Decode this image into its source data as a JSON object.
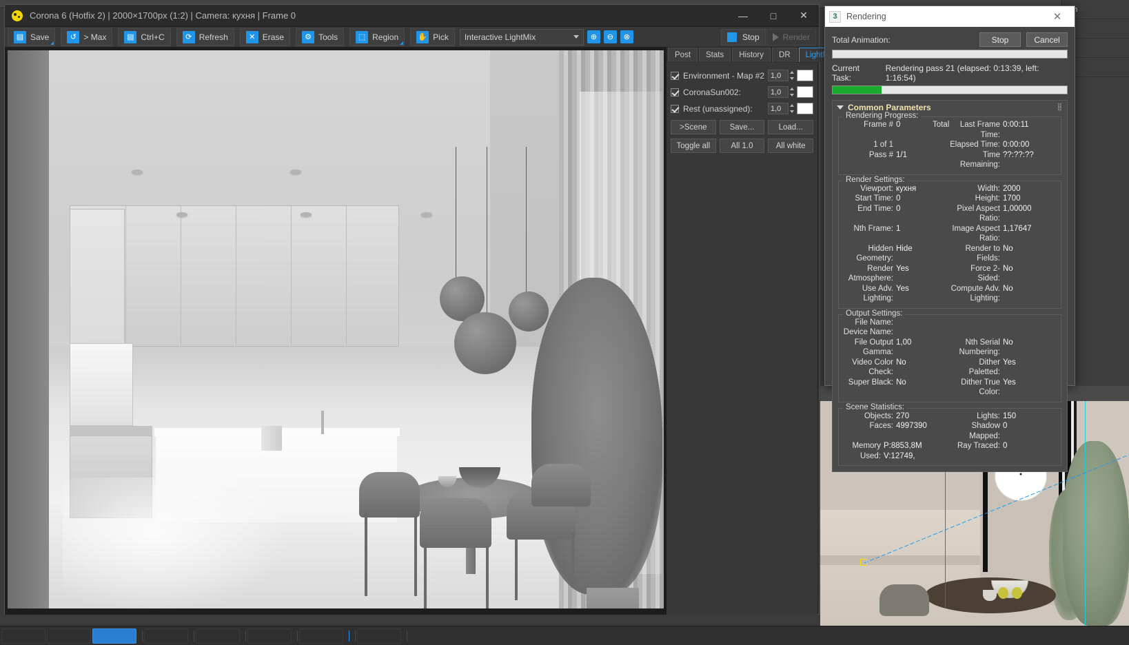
{
  "corona_window": {
    "title": "Corona 6 (Hotfix 2) | 2000×1700px (1:2) | Camera: кухня | Frame 0",
    "icon": "corona-logo-icon",
    "window_controls": {
      "minimize": "—",
      "maximize": "□",
      "close": "✕"
    },
    "toolbar": {
      "buttons": [
        {
          "name": "save",
          "label": "Save",
          "icon": "floppy-disk-icon",
          "has_arrow": true
        },
        {
          "name": "to-max",
          "label": "> Max",
          "icon": "max-swirl-icon",
          "has_arrow": false
        },
        {
          "name": "copy",
          "label": "Ctrl+C",
          "icon": "clipboard-icon",
          "has_arrow": false
        },
        {
          "name": "refresh",
          "label": "Refresh",
          "icon": "refresh-circle-icon",
          "has_arrow": false
        },
        {
          "name": "erase",
          "label": "Erase",
          "icon": "x-cross-icon",
          "has_arrow": false
        },
        {
          "name": "tools",
          "label": "Tools",
          "icon": "gear-icon",
          "has_arrow": false
        },
        {
          "name": "region",
          "label": "Region",
          "icon": "dashed-square-icon",
          "has_arrow": true
        },
        {
          "name": "pick",
          "label": "Pick",
          "icon": "hand-pick-icon",
          "has_arrow": false
        }
      ],
      "mode_select": {
        "value": "Interactive LightMix",
        "caret": "chevron-down-icon"
      },
      "zoom_buttons": [
        {
          "name": "zoom-in",
          "icon": "magnifier-plus-icon"
        },
        {
          "name": "zoom-out",
          "icon": "magnifier-minus-icon"
        },
        {
          "name": "zoom-reset",
          "icon": "magnifier-fit-icon"
        }
      ],
      "stop_label": "Stop",
      "render_label": "Render"
    },
    "side_panel": {
      "tabs": [
        {
          "label": "Post",
          "active": false
        },
        {
          "label": "Stats",
          "active": false
        },
        {
          "label": "History",
          "active": false
        },
        {
          "label": "DR",
          "active": false
        },
        {
          "label": "LightMix",
          "active": true
        }
      ],
      "lightmix_rows": [
        {
          "label": "Environment - Map #2",
          "checked": true,
          "value": "1,0",
          "color": "#ffffff"
        },
        {
          "label": "CoronaSun002:",
          "checked": true,
          "value": "1,0",
          "color": "#ffffff"
        },
        {
          "label": "Rest (unassigned):",
          "checked": true,
          "value": "1,0",
          "color": "#ffffff"
        }
      ],
      "buttons_row1": [
        {
          "name": "to-scene",
          "label": ">Scene"
        },
        {
          "name": "save-preset",
          "label": "Save..."
        },
        {
          "name": "load-preset",
          "label": "Load..."
        }
      ],
      "buttons_row2": [
        {
          "name": "toggle-all",
          "label": "Toggle all"
        },
        {
          "name": "all-one",
          "label": "All 1.0"
        },
        {
          "name": "all-white",
          "label": "All white"
        }
      ]
    }
  },
  "rendering_dialog": {
    "title": "Rendering",
    "icon": "max-render-icon",
    "icon_badge": "3",
    "close": "✕",
    "total_animation_label": "Total Animation:",
    "stop_label": "Stop",
    "cancel_label": "Cancel",
    "total_progress_percent": 0,
    "current_task_label": "Current Task:",
    "current_task_value": "Rendering pass 21 (elapsed: 0:13:39, left: 1:16:54)",
    "current_progress_percent": 21,
    "common_parameters": {
      "header": "Common Parameters",
      "rendering_progress": {
        "group_label": "Rendering Progress:",
        "left": [
          {
            "k": "Frame #",
            "v": "0"
          },
          {
            "k": "1 of 1",
            "v": ""
          },
          {
            "k": "Pass #",
            "v": "1/1"
          }
        ],
        "middle_note": "Total",
        "right": [
          {
            "k": "Last Frame Time:",
            "v": "0:00:11"
          },
          {
            "k": "Elapsed Time:",
            "v": "0:00:00"
          },
          {
            "k": "Time Remaining:",
            "v": "??:??:??"
          }
        ]
      },
      "render_settings": {
        "group_label": "Render Settings:",
        "left": [
          {
            "k": "Viewport:",
            "v": "кухня"
          },
          {
            "k": "Start Time:",
            "v": "0"
          },
          {
            "k": "End Time:",
            "v": "0"
          },
          {
            "k": "Nth Frame:",
            "v": "1"
          },
          {
            "k": "Hidden Geometry:",
            "v": "Hide"
          },
          {
            "k": "Render Atmosphere:",
            "v": "Yes"
          },
          {
            "k": "Use Adv. Lighting:",
            "v": "Yes"
          }
        ],
        "right": [
          {
            "k": "Width:",
            "v": "2000"
          },
          {
            "k": "Height:",
            "v": "1700"
          },
          {
            "k": "Pixel Aspect Ratio:",
            "v": "1,00000"
          },
          {
            "k": "Image Aspect Ratio:",
            "v": "1,17647"
          },
          {
            "k": "Render to Fields:",
            "v": "No"
          },
          {
            "k": "Force 2-Sided:",
            "v": "No"
          },
          {
            "k": "Compute Adv. Lighting:",
            "v": "No"
          }
        ]
      },
      "output_settings": {
        "group_label": "Output Settings:",
        "left": [
          {
            "k": "File Name:",
            "v": ""
          },
          {
            "k": "Device Name:",
            "v": ""
          },
          {
            "k": "File Output Gamma:",
            "v": "1,00"
          },
          {
            "k": "Video Color Check:",
            "v": "No"
          },
          {
            "k": "Super Black:",
            "v": "No"
          }
        ],
        "right": [
          {
            "k": "",
            "v": ""
          },
          {
            "k": "",
            "v": ""
          },
          {
            "k": "Nth Serial Numbering:",
            "v": "No"
          },
          {
            "k": "Dither Paletted:",
            "v": "Yes"
          },
          {
            "k": "Dither True Color:",
            "v": "Yes"
          }
        ]
      },
      "scene_statistics": {
        "group_label": "Scene Statistics:",
        "left": [
          {
            "k": "Objects:",
            "v": "270"
          },
          {
            "k": "Faces:",
            "v": "4997390"
          },
          {
            "k": "Memory Used:",
            "v": "P:8853,8M V:12749,"
          }
        ],
        "right": [
          {
            "k": "Lights:",
            "v": "150"
          },
          {
            "k": "Shadow Mapped:",
            "v": "0"
          },
          {
            "k": "Ray Traced:",
            "v": "0"
          }
        ]
      }
    }
  },
  "max_background": {
    "right_panel_hint": "n In",
    "viewport_name": ""
  },
  "colors": {
    "accent_blue": "#2196e8",
    "tab_active": "#36a0ef",
    "progress_green": "#1aab2e",
    "taskbar_active": "#2a7fd4",
    "rollout_header": "#f0e3b0"
  }
}
